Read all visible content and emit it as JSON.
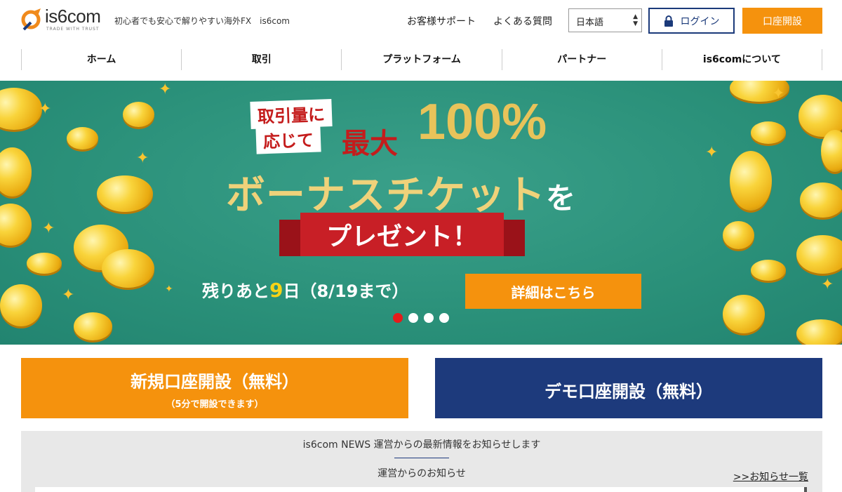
{
  "header": {
    "logo_text": "is6com",
    "logo_tagline": "TRADE WITH TRUST",
    "tagline": "初心者でも安心で解りやすい海外FX　is6com",
    "support_link": "お客様サポート",
    "faq_link": "よくある質問",
    "language_value": "日本語",
    "login_label": "ログイン",
    "open_account_label": "口座開設"
  },
  "nav": {
    "items": [
      "ホーム",
      "取引",
      "プラットフォーム",
      "パートナー",
      "is6comについて"
    ]
  },
  "banner": {
    "tag_line1": "取引量に",
    "tag_line2": "応じて",
    "max_label": "最大",
    "percent": "100%",
    "main_text": "ボーナスチケット",
    "main_suffix": "を",
    "ribbon_text": "プレゼント！",
    "remain_prefix": "残りあと",
    "remain_days": "9",
    "remain_suffix": "日（8/19まで）",
    "detail_label": "詳細はこちら",
    "slide_count": 4,
    "active_slide": 1,
    "colors": {
      "background": "#2a9079",
      "accent": "#f5920d",
      "ribbon": "#c81f26"
    }
  },
  "cta": {
    "open_title": "新規口座開設（無料）",
    "open_sub": "（5分で開設できます）",
    "demo_title": "デモ口座開設（無料）"
  },
  "news": {
    "title": "is6com NEWS 運営からの最新情報をお知らせします",
    "subtitle": "運営からのお知らせ",
    "all_link": ">>お知らせ一覧"
  },
  "colors": {
    "brand_orange": "#f5920d",
    "brand_navy": "#1d3a7c"
  }
}
